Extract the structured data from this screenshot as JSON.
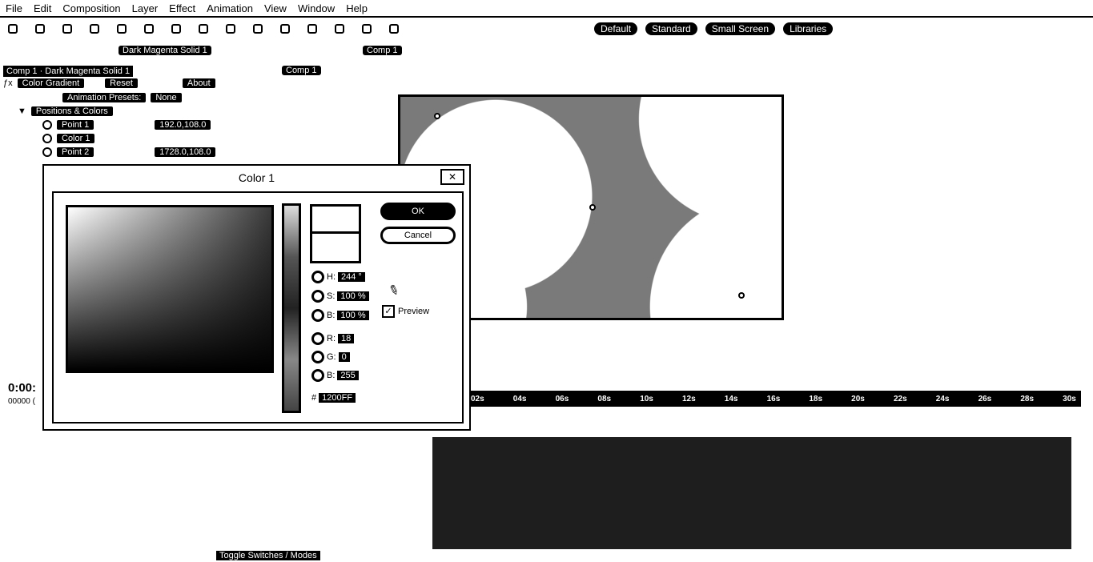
{
  "menu": [
    "File",
    "Edit",
    "Composition",
    "Layer",
    "Effect",
    "Animation",
    "View",
    "Window",
    "Help"
  ],
  "workspaces": [
    "Default",
    "Standard",
    "Small Screen",
    "Libraries"
  ],
  "panels": {
    "effect_controls_tab": "Dark Magenta Solid 1",
    "comp_tab": "Comp 1",
    "comp_crumb": "Comp 1"
  },
  "effect_controls": {
    "header": "Comp 1 · Dark Magenta Solid 1",
    "effect_name": "Color Gradient",
    "reset": "Reset",
    "about": "About",
    "presets_label": "Animation Presets:",
    "presets_value": "None",
    "group": "Positions & Colors",
    "point1_label": "Point 1",
    "point1_value": "192.0,108.0",
    "color1_label": "Color 1",
    "point2_label": "Point 2",
    "point2_value": "1728.0,108.0"
  },
  "timeline": {
    "time": "0:00:",
    "frames": "00000 (",
    "ticks": [
      "02s",
      "04s",
      "06s",
      "08s",
      "10s",
      "12s",
      "14s",
      "16s",
      "18s",
      "20s",
      "22s",
      "24s",
      "26s",
      "28s",
      "30s"
    ],
    "toggle_label": "Toggle Switches / Modes"
  },
  "dialog": {
    "title": "Color 1",
    "ok": "OK",
    "cancel": "Cancel",
    "h_label": "H:",
    "h_value": "244 °",
    "s_label": "S:",
    "s_value": "100 %",
    "b_label": "B:",
    "b_value": "100 %",
    "r_label": "R:",
    "r_value": "18",
    "g_label": "G:",
    "g_value": "0",
    "bl_label": "B:",
    "bl_value": "255",
    "hash": "#",
    "hex_value": "1200FF",
    "preview_label": "Preview"
  }
}
